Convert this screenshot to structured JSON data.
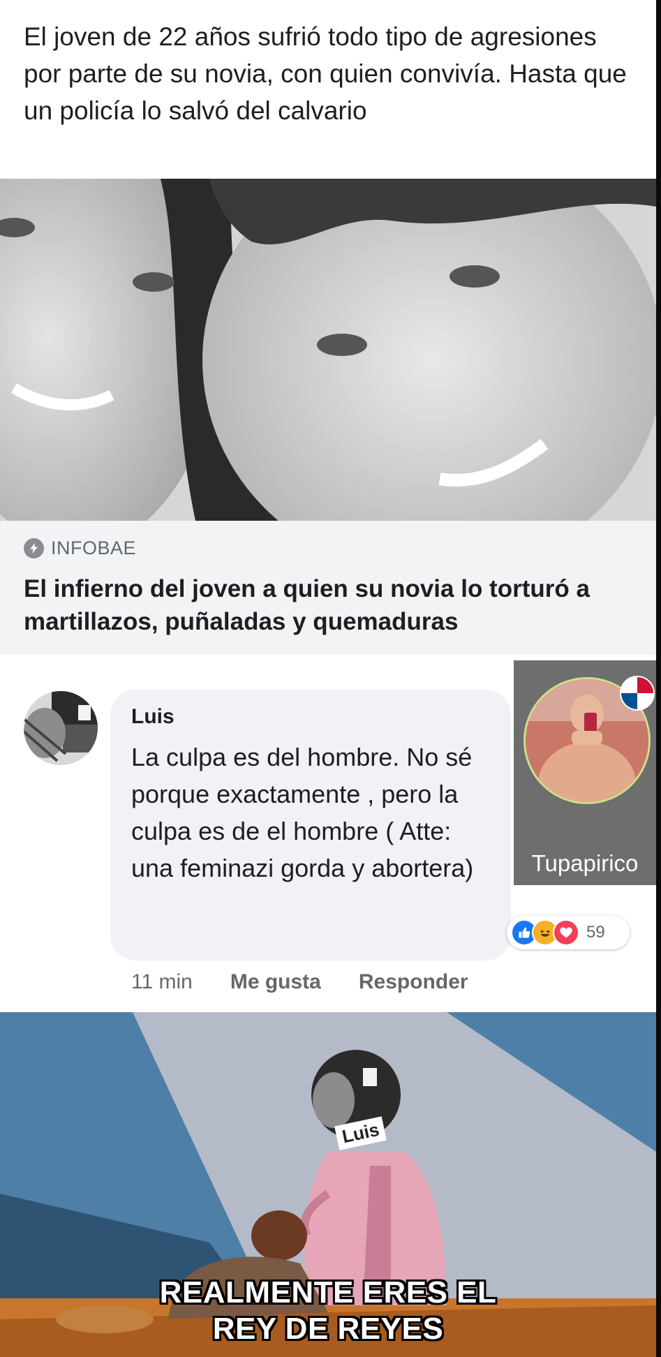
{
  "post": {
    "text": "El joven de 22 años sufrió todo tipo de agresiones por parte de su novia, con quien convivía. Hasta que un policía lo salvó del calvario"
  },
  "link": {
    "source": "INFOBAE",
    "source_icon": "bolt-icon",
    "title": "El infierno del joven a quien su novia lo torturó a martillazos, puñaladas y quemaduras"
  },
  "comment": {
    "author": "Luis",
    "text": "La culpa es del hombre. No sé porque exactamente , pero la culpa es de el hombre ( Atte: una feminazi gorda y abortera)",
    "reaction_count": "59",
    "time": "11 min",
    "like_label": "Me gusta",
    "reply_label": "Responder"
  },
  "profile": {
    "name": "Tupapirico",
    "flag": "panama-flag-icon"
  },
  "meme": {
    "tag": "Luis",
    "caption_line1": "REALMENTE ERES EL",
    "caption_line2": "REY DE REYES"
  },
  "colors": {
    "facebook_blue": "#1877f2",
    "haha_yellow": "#f7b125",
    "love_red": "#f33e58",
    "link_bg": "#f2f3f5",
    "bubble_bg": "#f0f2f5"
  }
}
